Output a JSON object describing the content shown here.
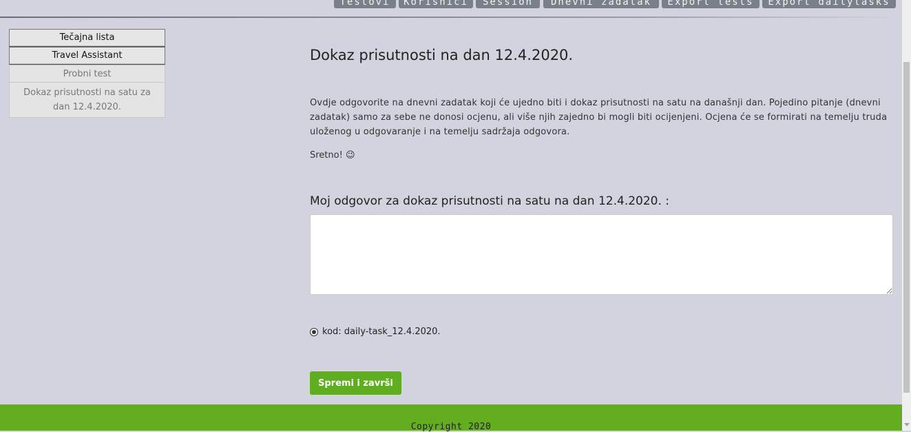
{
  "topnav": {
    "tabs": [
      {
        "label": "Testovi"
      },
      {
        "label": "Korisnici"
      },
      {
        "label": "Session"
      },
      {
        "label": "Dnevni zadatak"
      },
      {
        "label": "Export tests"
      },
      {
        "label": "Export dailytasks"
      }
    ]
  },
  "sidebar": {
    "buttons": [
      {
        "label": "Tečajna lista"
      },
      {
        "label": "Travel Assistant"
      }
    ],
    "items": [
      {
        "label": "Probni test"
      },
      {
        "label": "Dokaz prisutnosti na satu za dan 12.4.2020."
      }
    ]
  },
  "main": {
    "title": "Dokaz prisutnosti na dan 12.4.2020.",
    "intro": "Ovdje odgovorite na dnevni zadatak koji će ujedno biti i dokaz prisutnosti na satu na današnji dan. Pojedino pitanje (dnevni zadatak) samo za sebe ne donosi ocjenu, ali više njih zajedno bi mogli biti ocijenjeni. Ocjena će se formirati na temelju truda uloženog u odgovaranje i na temelju sadržaja odgovora.",
    "luck": "Sretno! 😉",
    "answer_label": "Moj odgovor za dokaz prisutnosti na satu na dan 12.4.2020. :",
    "answer_value": "",
    "code_label": "kod: daily-task_12.4.2020.",
    "submit_label": "Spremi i završi"
  },
  "footer": {
    "copyright": "Copyright 2020"
  },
  "colors": {
    "background": "#d3d3df",
    "accent_green": "#5fae20",
    "footer_green": "#62ae1f",
    "nav_tab": "#7a808a"
  }
}
